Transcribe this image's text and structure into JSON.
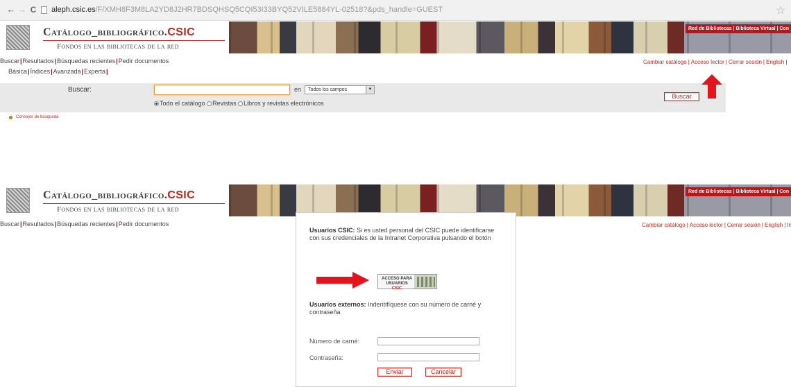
{
  "browser": {
    "back_glyph": "←",
    "forward_glyph": "→",
    "reload_glyph": "C",
    "url_host": "aleph.csic.es",
    "url_path": "/F/XMH8F3M8LA2YD8J2HR7BDSQHSQ5CQI53I33BYQ52VILE5884YL-02518?&pds_handle=GUEST",
    "bookmark_glyph": "☆"
  },
  "banner": {
    "title_main": "Catálogo_bibliográfico.",
    "title_brand": "CSIC",
    "subtitle": "Fondos en las bibliotecas de la red",
    "red_links": "Red de Bibliotecas | Biblioteca Virtual | Con"
  },
  "nav": {
    "items": [
      "Buscar",
      "Resultados",
      "Búsquedas recientes",
      "Pedir documentos"
    ],
    "sub_items": [
      "Básica",
      "Índices",
      "Avanzada",
      "Experta"
    ],
    "right_links": [
      "Cambiar catálogo",
      "Acceso lector",
      "Cerrar sesión",
      "English"
    ],
    "right_links_2_last": "In"
  },
  "search": {
    "label": "Buscar:",
    "value": "",
    "en_label": "en",
    "field_selected": "Todos los campos",
    "scopes": [
      {
        "label": "Todo el catálogo",
        "checked": true
      },
      {
        "label": "Revistas",
        "checked": false
      },
      {
        "label": "Libros y revistas electrónicos",
        "checked": false
      }
    ],
    "button": "Buscar",
    "tips": "Consejos de búsqueda"
  },
  "login": {
    "csic_heading": "Usuarios CSIC:",
    "csic_text_1": "Si es usted personal del CSIC puede identificarse",
    "csic_text_2": "con sus credenciales de la Intranet Corporativa pulsando el botón",
    "acceso_line1": "ACCESO PARA",
    "acceso_line2": "USUARIOS",
    "acceso_brand": "CSIC",
    "external_heading": "Usuarios externos:",
    "external_text_1": "Indentifíquese con su número de carné y",
    "external_text_2": "contraseña",
    "card_label": "Número de carné:",
    "card_value": "",
    "password_label": "Contraseña:",
    "password_value": "",
    "submit": "Enviar",
    "cancel": "Cancelar"
  },
  "colors": {
    "brand_red": "#c0281c",
    "arrow_red": "#e3141b",
    "panel_gray": "#e9e9e9"
  }
}
